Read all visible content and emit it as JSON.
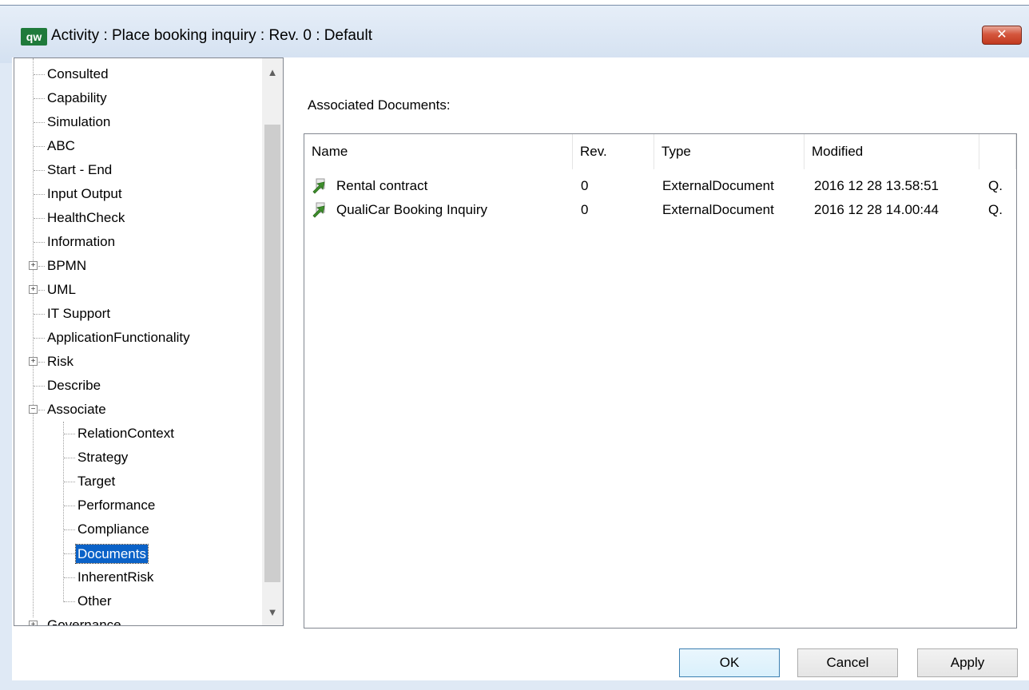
{
  "window": {
    "app_icon_text": "qw",
    "title": "Activity : Place booking inquiry : Rev. 0  : Default",
    "close_symbol": "✕"
  },
  "tree": {
    "items": [
      {
        "label": "Consulted",
        "level": 1
      },
      {
        "label": "Capability",
        "level": 1
      },
      {
        "label": "Simulation",
        "level": 1
      },
      {
        "label": "ABC",
        "level": 1
      },
      {
        "label": "Start - End",
        "level": 1
      },
      {
        "label": "Input Output",
        "level": 1
      },
      {
        "label": "HealthCheck",
        "level": 1
      },
      {
        "label": "Information",
        "level": 1
      },
      {
        "label": "BPMN",
        "level": 1,
        "expander": "+"
      },
      {
        "label": "UML",
        "level": 1,
        "expander": "+"
      },
      {
        "label": "IT Support",
        "level": 1
      },
      {
        "label": "ApplicationFunctionality",
        "level": 1
      },
      {
        "label": "Risk",
        "level": 1,
        "expander": "+"
      },
      {
        "label": "Describe",
        "level": 1
      },
      {
        "label": "Associate",
        "level": 1,
        "expander": "−"
      },
      {
        "label": "RelationContext",
        "level": 2
      },
      {
        "label": "Strategy",
        "level": 2
      },
      {
        "label": "Target",
        "level": 2
      },
      {
        "label": "Performance",
        "level": 2
      },
      {
        "label": "Compliance",
        "level": 2
      },
      {
        "label": "Documents",
        "level": 2,
        "selected": true
      },
      {
        "label": "InherentRisk",
        "level": 2
      },
      {
        "label": "Other",
        "level": 2
      },
      {
        "label": "Governance",
        "level": 1,
        "expander": "+"
      }
    ],
    "scroll_up": "▲",
    "scroll_down": "▼"
  },
  "associated": {
    "label": "Associated Documents:",
    "columns": [
      "Name",
      "Rev.",
      "Type",
      "Modified",
      ""
    ],
    "rows": [
      {
        "name": "Rental contract",
        "rev": "0",
        "type": "ExternalDocument",
        "modified": "2016 12 28 13.58:51",
        "extra": "Q."
      },
      {
        "name": "QualiCar Booking Inquiry",
        "rev": "0",
        "type": "ExternalDocument",
        "modified": "2016 12 28 14.00:44",
        "extra": "Q."
      }
    ]
  },
  "buttons": {
    "ok": "OK",
    "cancel": "Cancel",
    "apply": "Apply"
  }
}
